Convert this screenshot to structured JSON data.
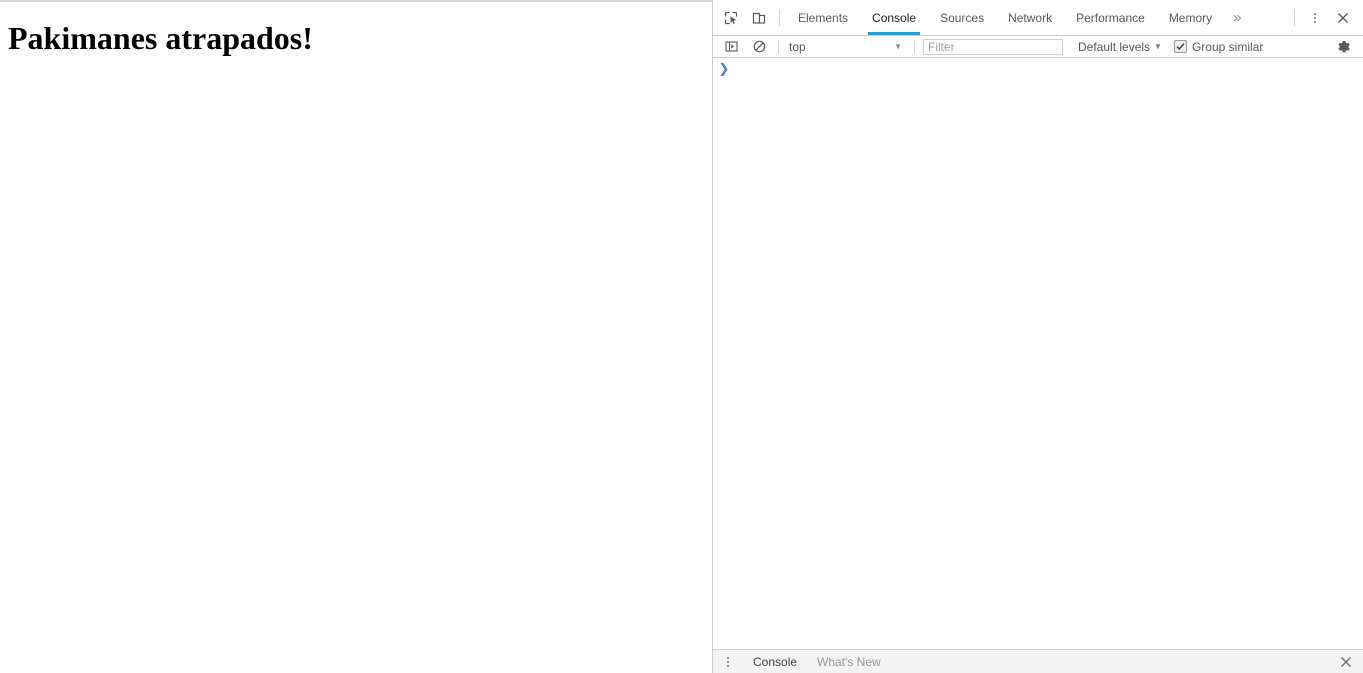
{
  "page": {
    "heading": "Pakimanes atrapados!"
  },
  "devtools": {
    "toolbar": {
      "inspect_icon": "inspect-element-icon",
      "device_toolbar_icon": "device-toolbar-icon",
      "more_tabs_label": "»",
      "main_menu_icon": "vertical-dots-icon",
      "close_icon": "close-icon",
      "tabs": [
        {
          "label": "Elements",
          "active": false
        },
        {
          "label": "Console",
          "active": true
        },
        {
          "label": "Sources",
          "active": false
        },
        {
          "label": "Network",
          "active": false
        },
        {
          "label": "Performance",
          "active": false
        },
        {
          "label": "Memory",
          "active": false
        }
      ],
      "active_tab_color": "#12a3e0"
    },
    "console_toolbar": {
      "sidebar_icon": "console-sidebar-icon",
      "clear_icon": "clear-console-icon",
      "context": {
        "value": "top",
        "caret": "▼"
      },
      "filter": {
        "value": "",
        "placeholder": "Filter"
      },
      "levels": {
        "label": "Default levels",
        "caret": "▼"
      },
      "group_similar": {
        "label": "Group similar",
        "checked": true,
        "check_glyph": "✔"
      },
      "settings_icon": "gear-icon"
    },
    "console": {
      "prompt_chevron": "❯",
      "prompt_value": ""
    },
    "drawer": {
      "menu_icon": "vertical-dots-icon",
      "tabs": [
        {
          "label": "Console",
          "active": true
        },
        {
          "label": "What's New",
          "active": false
        }
      ],
      "close_icon": "close-icon"
    }
  }
}
